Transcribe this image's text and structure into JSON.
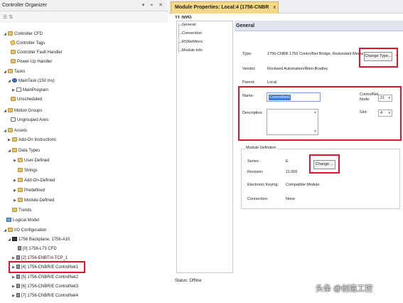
{
  "organizer": {
    "title": "Controller Organizer",
    "pane_buttons": "▾ ⌖ ✕",
    "toolbar_icons": "☰ ⇅",
    "nodes": [
      {
        "label": "Controller CFD"
      },
      {
        "label": "Controller Tags"
      },
      {
        "label": "Controller Fault Handler"
      },
      {
        "label": "Power-Up Handler"
      },
      {
        "label": "Tasks"
      },
      {
        "label": "MainTask (150 ms)"
      },
      {
        "label": "MainProgram"
      },
      {
        "label": "Unscheduled"
      },
      {
        "label": "Motion Groups"
      },
      {
        "label": "Ungrouped Axes"
      },
      {
        "label": "Assets"
      },
      {
        "label": "Add-On Instructions"
      },
      {
        "label": "Data Types"
      },
      {
        "label": "User-Defined"
      },
      {
        "label": "Strings"
      },
      {
        "label": "Add-On-Defined"
      },
      {
        "label": "Predefined"
      },
      {
        "label": "Module-Defined"
      },
      {
        "label": "Trends"
      },
      {
        "label": "Logical Model"
      },
      {
        "label": "I/O Configuration"
      },
      {
        "label": "1756 Backplane, 1756-A10"
      },
      {
        "label": "[0] 1756-L73 CFD"
      },
      {
        "label": "[2] 1756-ENBT/A TCP_1"
      },
      {
        "label": "[4] 1756-CNBR/E ControlNet1"
      },
      {
        "label": "[5] 1756-CNBR/E ControlNet2"
      },
      {
        "label": "[6] 1756-CNBR/E ControlNet3"
      },
      {
        "label": "[7] 1756-CNBR/E ControlNet4"
      }
    ]
  },
  "tab": {
    "title": "Module Properties: Local:4 (1756-CNBR 11.005)",
    "close": "x"
  },
  "categories": [
    "General",
    "Connection",
    "RSNetWorx",
    "Module Info"
  ],
  "general": {
    "heading": "General",
    "type_label": "Type:",
    "type_value": "1756-CNBR 1756 ControlNet Bridge, Redundant Media",
    "change_type_button": "Change Type...",
    "vendor_label": "Vendor:",
    "vendor_value": "Rockwell Automation/Allen-Bradley",
    "parent_label": "Parent:",
    "parent_value": "Local",
    "name_label": "Name:",
    "name_value": "ControlNet1",
    "description_label": "Description:",
    "node_label": "ControlNet Node:",
    "node_value": "21",
    "slot_label": "Slot:",
    "slot_value": "4",
    "module_definition_title": "Module Definition",
    "series_label": "Series:",
    "series_value": "E",
    "revision_label": "Revision:",
    "revision_value": "11.005",
    "keying_label": "Electronic Keying:",
    "keying_value": "Compatible Module",
    "connection_label": "Connection:",
    "connection_value": "None",
    "change_button": "Change ..."
  },
  "status": {
    "label": "Status:",
    "value": "Offline"
  },
  "watermark": "头条 @创造工控"
}
